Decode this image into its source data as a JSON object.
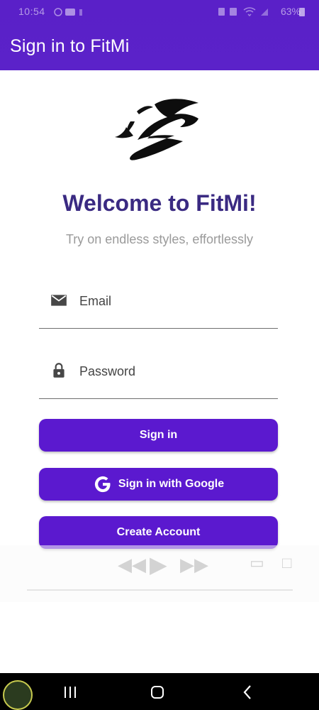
{
  "status_bar": {
    "time": "10:54",
    "battery": "63%"
  },
  "app_bar": {
    "title": "Sign in to FitMi"
  },
  "welcome": {
    "heading": "Welcome to FitMi!",
    "tagline": "Try on endless styles, effortlessly"
  },
  "form": {
    "email": {
      "placeholder": "Email",
      "value": "",
      "icon": "mail-icon"
    },
    "password": {
      "placeholder": "Password",
      "value": "",
      "icon": "lock-icon"
    }
  },
  "buttons": {
    "signin": "Sign in",
    "google": "Sign in with Google",
    "create": "Create Account"
  },
  "colors": {
    "primary": "#5b19cf",
    "app_bar": "#5a20c8",
    "heading": "#3a2a82",
    "tagline": "#9a9a9a"
  }
}
